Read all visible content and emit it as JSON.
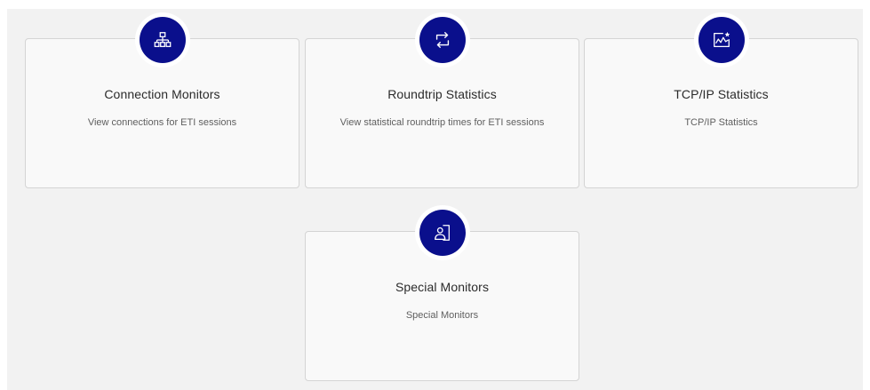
{
  "tiles": [
    {
      "title": "Connection Monitors",
      "description": "View connections for ETI sessions",
      "icon": "network-icon"
    },
    {
      "title": "Roundtrip Statistics",
      "description": "View statistical roundtrip times for ETI sessions",
      "icon": "roundtrip-icon"
    },
    {
      "title": "TCP/IP Statistics",
      "description": "TCP/IP Statistics",
      "icon": "statistics-chart-icon"
    },
    {
      "title": "Special Monitors",
      "description": "Special Monitors",
      "icon": "person-monitor-icon"
    }
  ],
  "colors": {
    "badge": "#0a0f8c",
    "card_background": "#f9f9f9",
    "page_background": "#f2f2f2"
  }
}
